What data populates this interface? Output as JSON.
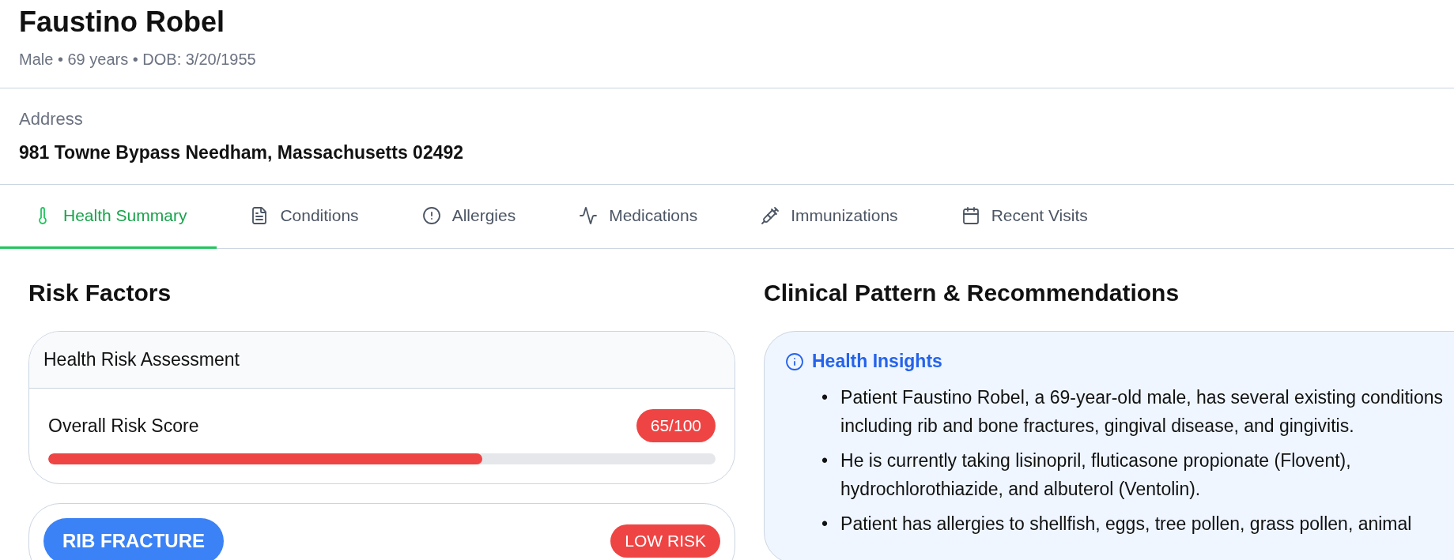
{
  "patient": {
    "name": "Faustino Robel",
    "details": "Male • 69 years • DOB: 3/20/1955"
  },
  "address": {
    "label": "Address",
    "value": "981 Towne Bypass Needham, Massachusetts 02492"
  },
  "tabs": [
    {
      "label": "Health Summary",
      "selected": true
    },
    {
      "label": "Conditions",
      "selected": false
    },
    {
      "label": "Allergies",
      "selected": false
    },
    {
      "label": "Medications",
      "selected": false
    },
    {
      "label": "Immunizations",
      "selected": false
    },
    {
      "label": "Recent Visits",
      "selected": false
    }
  ],
  "risk_factors": {
    "heading": "Risk Factors",
    "assessment": {
      "title": "Health Risk Assessment",
      "score_label": "Overall Risk Score",
      "score": "65/100",
      "level": 0.65
    },
    "items": [
      {
        "condition": "RIB FRACTURE",
        "risk": "LOW RISK"
      }
    ]
  },
  "clinical": {
    "heading": "Clinical Pattern & Recommendations",
    "insights": {
      "title": "Health Insights",
      "bullets": [
        {
          "marker": "•",
          "text": "Patient Faustino Robel, a 69-year-old male, has several existing conditions including rib and bone fractures, gingival disease, and gingivitis."
        },
        {
          "marker": "•",
          "text": "He is currently taking lisinopril, fluticasone propionate (Flovent), hydrochlorothiazide, and albuterol (Ventolin)."
        },
        {
          "marker": "•",
          "text": "Patient has allergies to shellfish, eggs, tree pollen, grass pollen, animal"
        }
      ]
    }
  }
}
